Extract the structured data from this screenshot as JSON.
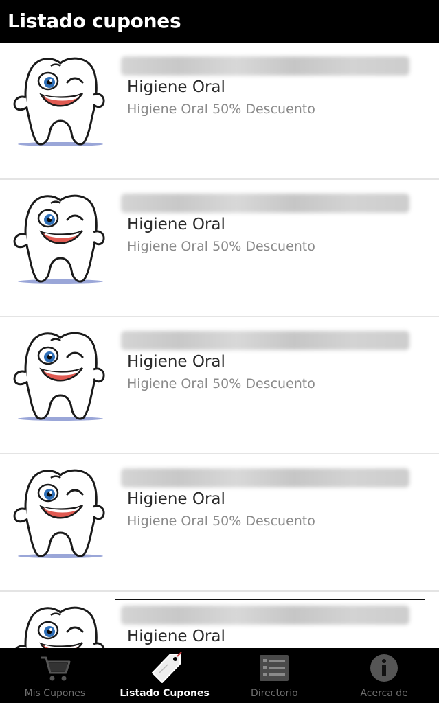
{
  "header": {
    "title": "Listado cupones"
  },
  "coupons": [
    {
      "title": "Higiene Oral",
      "description": "Higiene Oral 50% Descuento"
    },
    {
      "title": "Higiene Oral",
      "description": "Higiene Oral 50% Descuento"
    },
    {
      "title": "Higiene Oral",
      "description": "Higiene Oral 50% Descuento"
    },
    {
      "title": "Higiene Oral",
      "description": "Higiene Oral 50% Descuento"
    },
    {
      "title": "Higiene Oral",
      "description": ""
    }
  ],
  "tabs": [
    {
      "label": "Mis Cupones",
      "icon": "cart-icon",
      "active": false
    },
    {
      "label": "Listado Cupones",
      "icon": "tag-icon",
      "active": true
    },
    {
      "label": "Directorio",
      "icon": "list-icon",
      "active": false
    },
    {
      "label": "Acerca de",
      "icon": "info-icon",
      "active": false
    }
  ],
  "colors": {
    "header_bg": "#000000",
    "tab_active": "#ffffff",
    "tab_inactive": "#6e6e6e",
    "description_text": "#8a8a8a"
  }
}
